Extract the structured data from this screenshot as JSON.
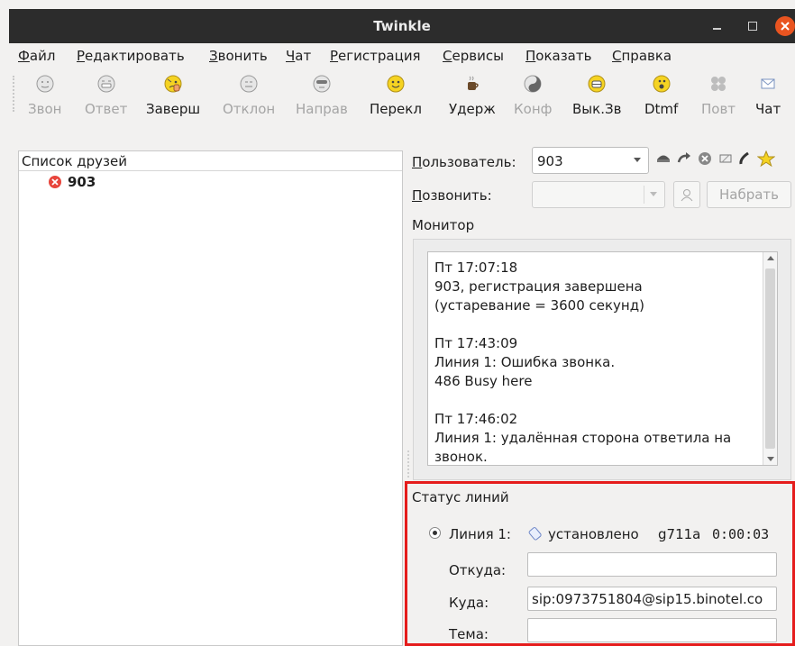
{
  "window": {
    "title": "Twinkle"
  },
  "menu": [
    "Файл",
    "Редактировать",
    "Звонить",
    "Чат",
    "Регистрация",
    "Сервисы",
    "Показать",
    "Справка"
  ],
  "toolbar": [
    {
      "label": "Звон",
      "icon": "ring-icon",
      "enabled": false
    },
    {
      "label": "Ответ",
      "icon": "answer-icon",
      "enabled": false
    },
    {
      "label": "Заверш",
      "icon": "hangup-icon",
      "enabled": true
    },
    {
      "label": "Отклон",
      "icon": "reject-icon",
      "enabled": false
    },
    {
      "label": "Направ",
      "icon": "redirect-icon",
      "enabled": false
    },
    {
      "label": "Перекл",
      "icon": "transfer-icon",
      "enabled": true
    },
    {
      "label": "Удерж",
      "icon": "hold-icon",
      "enabled": true
    },
    {
      "label": "Конф",
      "icon": "conference-icon",
      "enabled": false
    },
    {
      "label": "Вык.Зв",
      "icon": "mute-icon",
      "enabled": true
    },
    {
      "label": "Dtmf",
      "icon": "dtmf-icon",
      "enabled": true
    },
    {
      "label": "Повт",
      "icon": "redial-icon",
      "enabled": false
    },
    {
      "label": "Чат",
      "icon": "chat-icon",
      "enabled": true
    }
  ],
  "buddy_list": {
    "header": "Список друзей",
    "items": [
      {
        "name": "903",
        "status": "offline"
      }
    ]
  },
  "user": {
    "label": "Пользователь:",
    "value": "903"
  },
  "call": {
    "label": "Позвонить:",
    "value": "",
    "dial_button": "Набрать"
  },
  "monitor": {
    "title": "Монитор",
    "entries": [
      {
        "time": "Пт 17:07:18",
        "lines": [
          "903, регистрация завершена",
          "(устаревание = 3600 секунд)"
        ]
      },
      {
        "time": "Пт 17:43:09",
        "lines": [
          "Линия 1: Ошибка звонка.",
          "486 Busy here"
        ]
      },
      {
        "time": "Пт 17:46:02",
        "lines": [
          "Линия 1: удалённая сторона ответила на",
          "звонок."
        ]
      }
    ]
  },
  "line_status": {
    "title": "Статус линий",
    "line_label": "Линия 1:",
    "state": "установлено",
    "codec": "g711a",
    "duration": "0:00:03",
    "from_label": "Откуда:",
    "from_value": "",
    "to_label": "Куда:",
    "to_value": "sip:0973751804@sip15.binotel.co",
    "subject_label": "Тема:",
    "subject_value": ""
  },
  "colors": {
    "titlebar": "#2c2c2c",
    "close": "#e95420",
    "highlight": "#e51c1c",
    "smiley": "#f5d322"
  }
}
